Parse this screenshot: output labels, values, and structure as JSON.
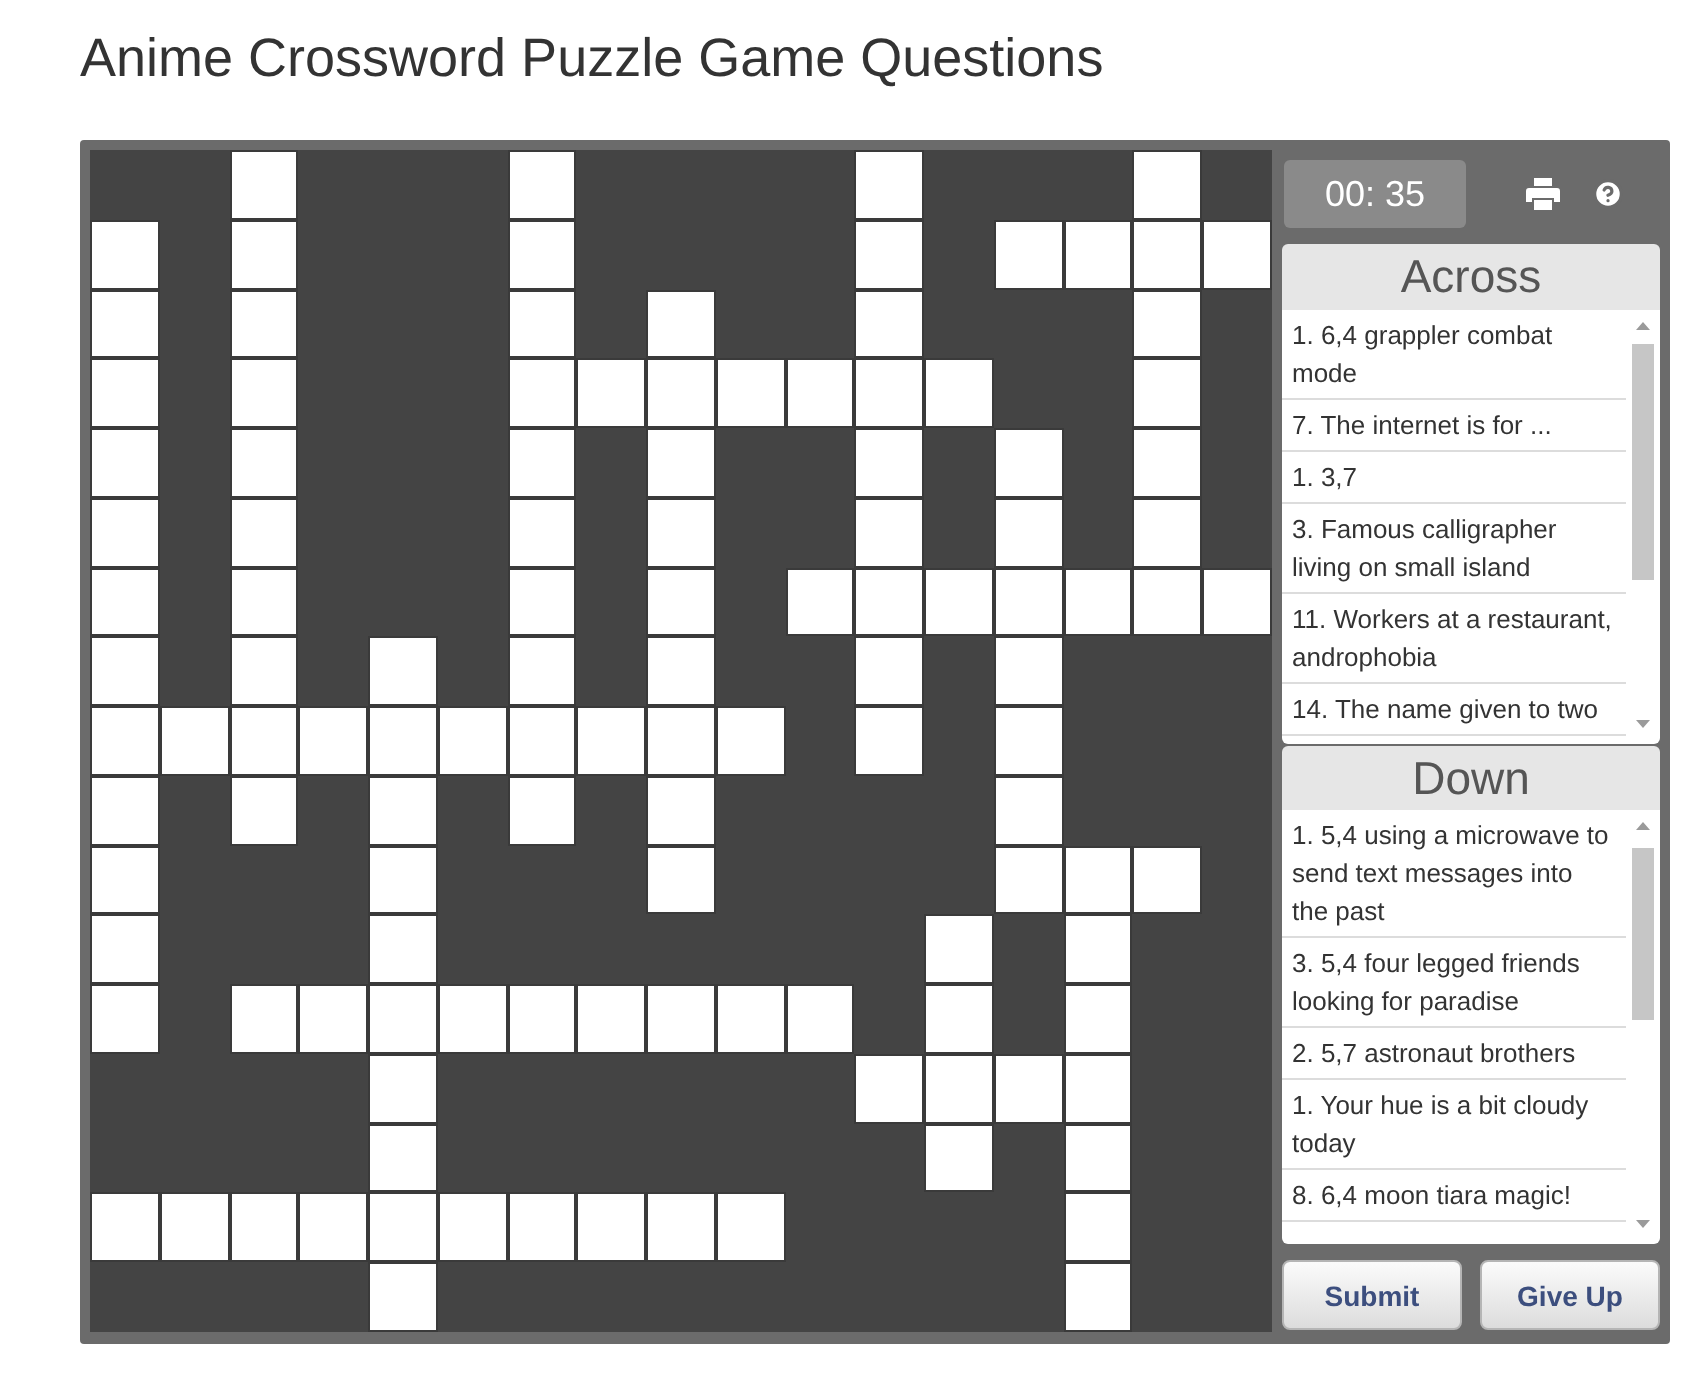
{
  "title": "Anime Crossword Puzzle Game Questions",
  "grid": {
    "rows": [
      {
        "cells": [
          {
            "kind": "block"
          },
          {
            "kind": "block"
          },
          {
            "kind": "open"
          },
          {
            "kind": "block"
          },
          {
            "kind": "block"
          },
          {
            "kind": "block"
          },
          {
            "kind": "open"
          },
          {
            "kind": "block"
          },
          {
            "kind": "block"
          },
          {
            "kind": "block"
          },
          {
            "kind": "block"
          },
          {
            "kind": "open"
          },
          {
            "kind": "block"
          },
          {
            "kind": "block"
          },
          {
            "kind": "block"
          },
          {
            "kind": "open"
          },
          {
            "kind": "block"
          }
        ]
      },
      {
        "cells": [
          {
            "kind": "open"
          },
          {
            "kind": "block"
          },
          {
            "kind": "open"
          },
          {
            "kind": "block"
          },
          {
            "kind": "block"
          },
          {
            "kind": "block"
          },
          {
            "kind": "open"
          },
          {
            "kind": "block"
          },
          {
            "kind": "block"
          },
          {
            "kind": "block"
          },
          {
            "kind": "block"
          },
          {
            "kind": "open"
          },
          {
            "kind": "block"
          },
          {
            "kind": "open"
          },
          {
            "kind": "open"
          },
          {
            "kind": "open"
          },
          {
            "kind": "open"
          }
        ]
      },
      {
        "cells": [
          {
            "kind": "open"
          },
          {
            "kind": "block"
          },
          {
            "kind": "open"
          },
          {
            "kind": "block"
          },
          {
            "kind": "block"
          },
          {
            "kind": "block"
          },
          {
            "kind": "open"
          },
          {
            "kind": "block"
          },
          {
            "kind": "open"
          },
          {
            "kind": "block"
          },
          {
            "kind": "block"
          },
          {
            "kind": "open"
          },
          {
            "kind": "block"
          },
          {
            "kind": "block"
          },
          {
            "kind": "block"
          },
          {
            "kind": "open"
          },
          {
            "kind": "block"
          }
        ]
      },
      {
        "cells": [
          {
            "kind": "open"
          },
          {
            "kind": "block"
          },
          {
            "kind": "open"
          },
          {
            "kind": "block"
          },
          {
            "kind": "block"
          },
          {
            "kind": "block"
          },
          {
            "kind": "open"
          },
          {
            "kind": "open"
          },
          {
            "kind": "open"
          },
          {
            "kind": "open"
          },
          {
            "kind": "open"
          },
          {
            "kind": "open"
          },
          {
            "kind": "open"
          },
          {
            "kind": "block"
          },
          {
            "kind": "block"
          },
          {
            "kind": "open"
          },
          {
            "kind": "block"
          }
        ]
      },
      {
        "cells": [
          {
            "kind": "open"
          },
          {
            "kind": "block"
          },
          {
            "kind": "open"
          },
          {
            "kind": "block"
          },
          {
            "kind": "block"
          },
          {
            "kind": "block"
          },
          {
            "kind": "open"
          },
          {
            "kind": "block"
          },
          {
            "kind": "open"
          },
          {
            "kind": "block"
          },
          {
            "kind": "block"
          },
          {
            "kind": "open"
          },
          {
            "kind": "block"
          },
          {
            "kind": "open"
          },
          {
            "kind": "block"
          },
          {
            "kind": "open"
          },
          {
            "kind": "block"
          }
        ]
      },
      {
        "cells": [
          {
            "kind": "open"
          },
          {
            "kind": "block"
          },
          {
            "kind": "open"
          },
          {
            "kind": "block"
          },
          {
            "kind": "block"
          },
          {
            "kind": "block"
          },
          {
            "kind": "open"
          },
          {
            "kind": "block"
          },
          {
            "kind": "open"
          },
          {
            "kind": "block"
          },
          {
            "kind": "block"
          },
          {
            "kind": "open"
          },
          {
            "kind": "block"
          },
          {
            "kind": "open"
          },
          {
            "kind": "block"
          },
          {
            "kind": "open"
          },
          {
            "kind": "block"
          }
        ]
      },
      {
        "cells": [
          {
            "kind": "open"
          },
          {
            "kind": "block"
          },
          {
            "kind": "open"
          },
          {
            "kind": "block"
          },
          {
            "kind": "block"
          },
          {
            "kind": "block"
          },
          {
            "kind": "open"
          },
          {
            "kind": "block"
          },
          {
            "kind": "open"
          },
          {
            "kind": "block"
          },
          {
            "kind": "open"
          },
          {
            "kind": "open"
          },
          {
            "kind": "open"
          },
          {
            "kind": "open"
          },
          {
            "kind": "open"
          },
          {
            "kind": "open"
          },
          {
            "kind": "open"
          }
        ]
      },
      {
        "cells": [
          {
            "kind": "open"
          },
          {
            "kind": "block"
          },
          {
            "kind": "open"
          },
          {
            "kind": "block"
          },
          {
            "kind": "open"
          },
          {
            "kind": "block"
          },
          {
            "kind": "open"
          },
          {
            "kind": "block"
          },
          {
            "kind": "open"
          },
          {
            "kind": "block"
          },
          {
            "kind": "block"
          },
          {
            "kind": "open"
          },
          {
            "kind": "block"
          },
          {
            "kind": "open"
          },
          {
            "kind": "block"
          },
          {
            "kind": "block"
          },
          {
            "kind": "block"
          }
        ]
      },
      {
        "cells": [
          {
            "kind": "open"
          },
          {
            "kind": "open"
          },
          {
            "kind": "open"
          },
          {
            "kind": "open"
          },
          {
            "kind": "open"
          },
          {
            "kind": "open"
          },
          {
            "kind": "open"
          },
          {
            "kind": "open"
          },
          {
            "kind": "open"
          },
          {
            "kind": "open"
          },
          {
            "kind": "block"
          },
          {
            "kind": "open"
          },
          {
            "kind": "block"
          },
          {
            "kind": "open"
          },
          {
            "kind": "block"
          },
          {
            "kind": "block"
          },
          {
            "kind": "block"
          }
        ]
      },
      {
        "cells": [
          {
            "kind": "open"
          },
          {
            "kind": "block"
          },
          {
            "kind": "open"
          },
          {
            "kind": "block"
          },
          {
            "kind": "open"
          },
          {
            "kind": "block"
          },
          {
            "kind": "open"
          },
          {
            "kind": "block"
          },
          {
            "kind": "open"
          },
          {
            "kind": "block"
          },
          {
            "kind": "block"
          },
          {
            "kind": "block"
          },
          {
            "kind": "block"
          },
          {
            "kind": "open"
          },
          {
            "kind": "block"
          },
          {
            "kind": "block"
          },
          {
            "kind": "block"
          }
        ]
      },
      {
        "cells": [
          {
            "kind": "open"
          },
          {
            "kind": "block"
          },
          {
            "kind": "block"
          },
          {
            "kind": "block"
          },
          {
            "kind": "open"
          },
          {
            "kind": "block"
          },
          {
            "kind": "block"
          },
          {
            "kind": "block"
          },
          {
            "kind": "open"
          },
          {
            "kind": "block"
          },
          {
            "kind": "block"
          },
          {
            "kind": "block"
          },
          {
            "kind": "block"
          },
          {
            "kind": "open"
          },
          {
            "kind": "open"
          },
          {
            "kind": "open"
          },
          {
            "kind": "block"
          }
        ]
      },
      {
        "cells": [
          {
            "kind": "open"
          },
          {
            "kind": "block"
          },
          {
            "kind": "block"
          },
          {
            "kind": "block"
          },
          {
            "kind": "open"
          },
          {
            "kind": "block"
          },
          {
            "kind": "block"
          },
          {
            "kind": "block"
          },
          {
            "kind": "block"
          },
          {
            "kind": "block"
          },
          {
            "kind": "block"
          },
          {
            "kind": "block"
          },
          {
            "kind": "open"
          },
          {
            "kind": "block"
          },
          {
            "kind": "open"
          },
          {
            "kind": "block"
          },
          {
            "kind": "block"
          }
        ]
      },
      {
        "cells": [
          {
            "kind": "open"
          },
          {
            "kind": "block"
          },
          {
            "kind": "open"
          },
          {
            "kind": "open"
          },
          {
            "kind": "open"
          },
          {
            "kind": "open"
          },
          {
            "kind": "open"
          },
          {
            "kind": "open"
          },
          {
            "kind": "open"
          },
          {
            "kind": "open"
          },
          {
            "kind": "open"
          },
          {
            "kind": "block"
          },
          {
            "kind": "open"
          },
          {
            "kind": "block"
          },
          {
            "kind": "open"
          },
          {
            "kind": "block"
          },
          {
            "kind": "block"
          }
        ]
      },
      {
        "cells": [
          {
            "kind": "block"
          },
          {
            "kind": "block"
          },
          {
            "kind": "block"
          },
          {
            "kind": "block"
          },
          {
            "kind": "open"
          },
          {
            "kind": "block"
          },
          {
            "kind": "block"
          },
          {
            "kind": "block"
          },
          {
            "kind": "block"
          },
          {
            "kind": "block"
          },
          {
            "kind": "block"
          },
          {
            "kind": "open"
          },
          {
            "kind": "open"
          },
          {
            "kind": "open"
          },
          {
            "kind": "open"
          },
          {
            "kind": "block"
          },
          {
            "kind": "block"
          }
        ]
      },
      {
        "cells": [
          {
            "kind": "block"
          },
          {
            "kind": "block"
          },
          {
            "kind": "block"
          },
          {
            "kind": "block"
          },
          {
            "kind": "open"
          },
          {
            "kind": "block"
          },
          {
            "kind": "block"
          },
          {
            "kind": "block"
          },
          {
            "kind": "block"
          },
          {
            "kind": "block"
          },
          {
            "kind": "block"
          },
          {
            "kind": "block"
          },
          {
            "kind": "open"
          },
          {
            "kind": "block"
          },
          {
            "kind": "open"
          },
          {
            "kind": "block"
          },
          {
            "kind": "block"
          }
        ]
      },
      {
        "cells": [
          {
            "kind": "open"
          },
          {
            "kind": "open"
          },
          {
            "kind": "open"
          },
          {
            "kind": "open"
          },
          {
            "kind": "open"
          },
          {
            "kind": "open"
          },
          {
            "kind": "open"
          },
          {
            "kind": "open"
          },
          {
            "kind": "open"
          },
          {
            "kind": "open"
          },
          {
            "kind": "block"
          },
          {
            "kind": "block"
          },
          {
            "kind": "block"
          },
          {
            "kind": "block"
          },
          {
            "kind": "open"
          },
          {
            "kind": "block"
          },
          {
            "kind": "block"
          }
        ]
      },
      {
        "cells": [
          {
            "kind": "block"
          },
          {
            "kind": "block"
          },
          {
            "kind": "block"
          },
          {
            "kind": "block"
          },
          {
            "kind": "open"
          },
          {
            "kind": "block"
          },
          {
            "kind": "block"
          },
          {
            "kind": "block"
          },
          {
            "kind": "block"
          },
          {
            "kind": "block"
          },
          {
            "kind": "block"
          },
          {
            "kind": "block"
          },
          {
            "kind": "block"
          },
          {
            "kind": "block"
          },
          {
            "kind": "open"
          },
          {
            "kind": "block"
          },
          {
            "kind": "block"
          }
        ]
      }
    ]
  },
  "timer": "00: 35",
  "across": {
    "heading": "Across",
    "clues": [
      "1. 6,4 grappler combat mode",
      "7. The internet is for ...",
      "1. 3,7",
      "3. Famous calligrapher living on small island",
      "11. Workers at a restaurant, androphobia",
      "14. The name given to two"
    ]
  },
  "down": {
    "heading": "Down",
    "clues": [
      "1. 5,4 using a microwave to send text messages into the past",
      "3. 5,4 four legged friends looking for paradise",
      "2. 5,7 astronaut brothers",
      "1. Your hue is a bit cloudy today",
      "8. 6,4 moon tiara magic!"
    ]
  },
  "buttons": [
    "Submit",
    "Give Up"
  ]
}
